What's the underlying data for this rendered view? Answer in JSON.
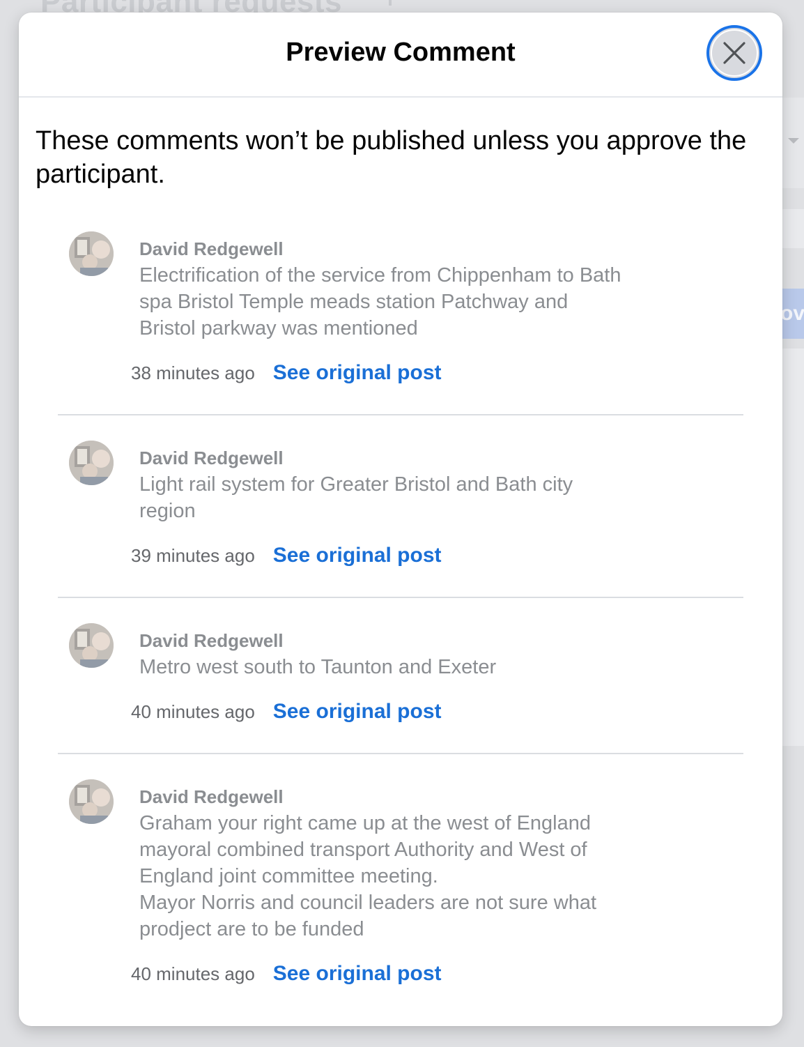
{
  "background": {
    "page_title": "Participant requests",
    "approve_fragment": "ov"
  },
  "modal": {
    "title": "Preview Comment",
    "notice": "These comments won’t be published unless you approve the participant.",
    "notice_lines": [
      "These comments won’t be published unless you approve the",
      "participant."
    ]
  },
  "comments": [
    {
      "author": "David Redgewell",
      "lines": [
        "Electrification of the service from Chippenham to Bath",
        "spa Bristol Temple meads station Patchway and",
        "Bristol parkway was mentioned"
      ],
      "time": "38 minutes ago",
      "link": "See original post"
    },
    {
      "author": "David Redgewell",
      "lines": [
        "Light rail system for Greater Bristol and Bath city",
        "region"
      ],
      "time": "39 minutes ago",
      "link": "See original post"
    },
    {
      "author": "David Redgewell",
      "lines": [
        "Metro west south to Taunton and Exeter"
      ],
      "time": "40 minutes ago",
      "link": "See original post"
    },
    {
      "author": "David Redgewell",
      "lines": [
        "Graham your right came up at the west of England",
        "mayoral combined transport Authority and West of",
        "England joint committee meeting.",
        "Mayor Norris and council leaders are not sure what",
        "prodject are to be funded"
      ],
      "time": "40 minutes ago",
      "link": "See original post"
    }
  ],
  "colors": {
    "link": "#1a6fd6",
    "focus_ring": "#1a73e8",
    "muted_text": "#8a8d91"
  }
}
